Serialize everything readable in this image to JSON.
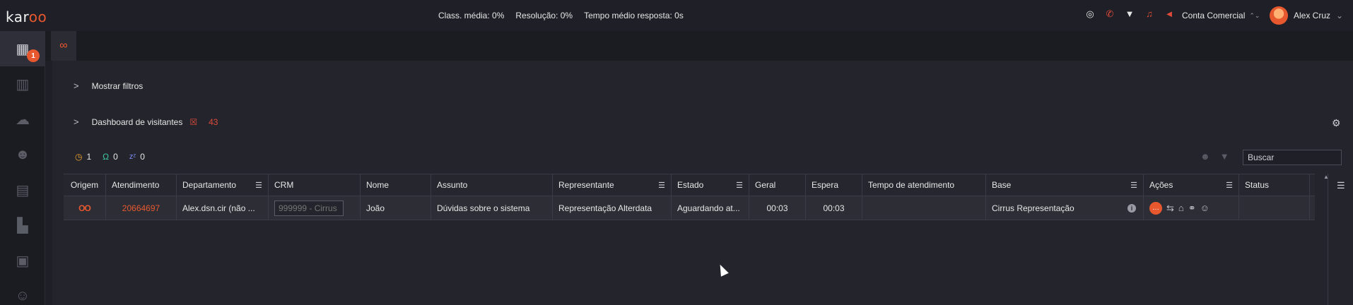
{
  "logo": {
    "prefix": "kar",
    "suffix": "oo"
  },
  "stats": {
    "classification": "Class. média: 0%",
    "resolution": "Resolução: 0%",
    "avg_response": "Tempo médio resposta: 0s"
  },
  "top_icons": [
    "whatsapp-icon",
    "phone-off-icon",
    "wifi-icon",
    "bell-off-icon",
    "volume-off-icon"
  ],
  "account": {
    "label": "Conta Comercial",
    "arrow": "⌃⌄"
  },
  "user": {
    "name": "Alex Cruz",
    "arrow": "⌄"
  },
  "sidebar": {
    "items": [
      {
        "icon": "table-icon",
        "badge": "1"
      },
      {
        "icon": "chart-icon"
      },
      {
        "icon": "chat-icon"
      },
      {
        "icon": "users-icon"
      },
      {
        "icon": "search-report-icon"
      },
      {
        "icon": "building-icon"
      },
      {
        "icon": "contact-card-icon"
      },
      {
        "icon": "user-search-icon"
      }
    ]
  },
  "tab": {
    "icon": "binoculars-icon"
  },
  "filters": {
    "label": "Mostrar filtros"
  },
  "visitors": {
    "label": "Dashboard de visitantes",
    "count": "43"
  },
  "counters": {
    "waiting": "1",
    "in_service": "0",
    "sleeping": "0"
  },
  "search": {
    "placeholder": "Buscar"
  },
  "table": {
    "headers": [
      "Origem",
      "Atendimento",
      "Departamento",
      "CRM",
      "Nome",
      "Assunto",
      "Representante",
      "Estado",
      "Geral",
      "Espera",
      "Tempo de atendimento",
      "Base",
      "Ações",
      "Status"
    ],
    "row": {
      "origin_icon": "OO",
      "atendimento": "20664697",
      "departamento": "Alex.dsn.cir (não ...",
      "crm_placeholder": "999999 - Cirrus",
      "nome": "João",
      "assunto": "Dúvidas sobre o sistema",
      "representante": "Representação Alterdata",
      "estado": "Aguardando at...",
      "geral": "00:03",
      "espera": "00:03",
      "tempo": "",
      "base": "Cirrus Representação",
      "status": ""
    }
  }
}
